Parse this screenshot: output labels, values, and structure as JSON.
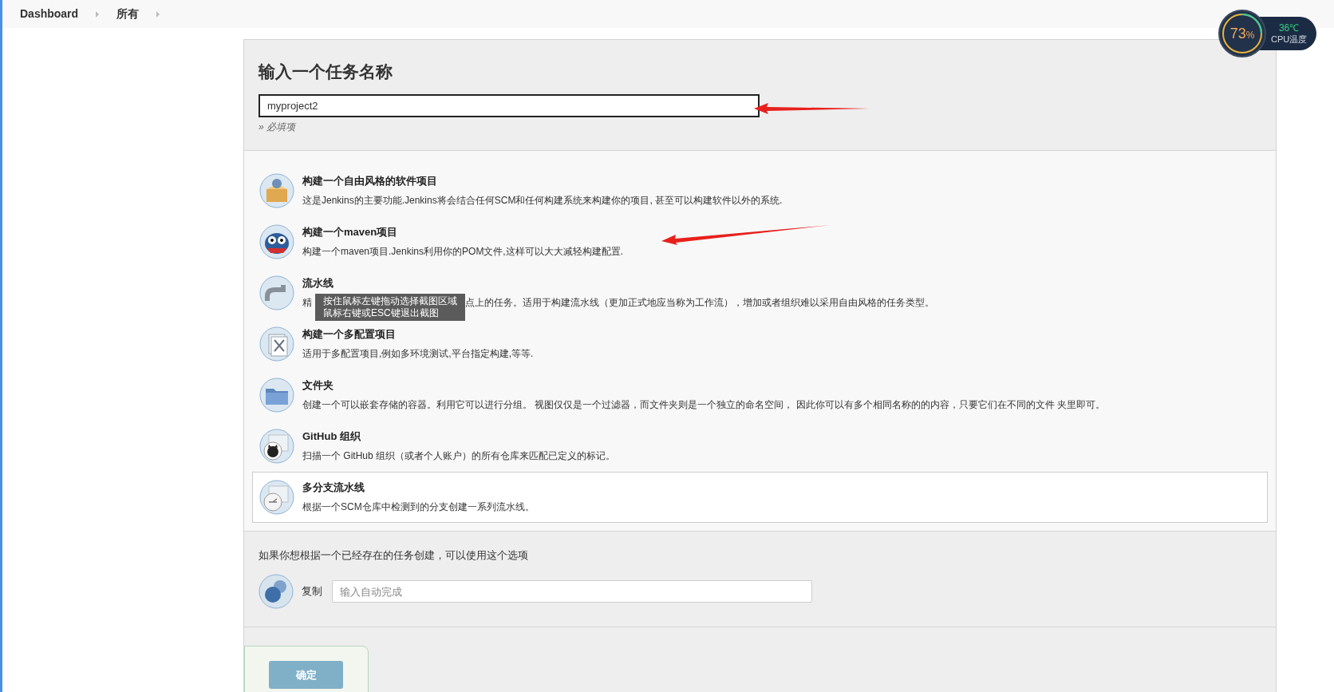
{
  "breadcrumbs": [
    {
      "label": "Dashboard"
    },
    {
      "label": "所有"
    }
  ],
  "form": {
    "title": "输入一个任务名称",
    "name_field": {
      "value": "myproject2"
    },
    "hint": "» 必填项"
  },
  "item_types": [
    {
      "title": "构建一个自由风格的软件项目",
      "description": "这是Jenkins的主要功能.Jenkins将会结合任何SCM和任何构建系统来构建你的项目, 甚至可以构建软件以外的系统.",
      "selected": false
    },
    {
      "title": "构建一个maven项目",
      "description": "构建一个maven项目.Jenkins利用你的POM文件,这样可以大大减轻构建配置.",
      "selected": false
    },
    {
      "title": "流水线",
      "description_parts": [
        "精",
        "点上的任务。适用于构建流水线（更加正式地应当称为工作流），增加或者组织难以采用自由风格的任务类型。"
      ],
      "selected": false
    },
    {
      "title": "构建一个多配置项目",
      "description": "适用于多配置项目,例如多环境测试,平台指定构建,等等.",
      "selected": false
    },
    {
      "title": "文件夹",
      "description": "创建一个可以嵌套存储的容器。利用它可以进行分组。 视图仅仅是一个过滤器，而文件夹则是一个独立的命名空间， 因此你可以有多个相同名称的的内容，只要它们在不同的文件 夹里即可。",
      "selected": false
    },
    {
      "title": "GitHub 组织",
      "description": "扫描一个 GitHub 组织（或者个人账户）的所有仓库来匹配已定义的标记。",
      "selected": false
    },
    {
      "title": "多分支流水线",
      "description": "根据一个SCM仓库中检测到的分支创建一系列流水线。",
      "selected": true
    }
  ],
  "copy_section": {
    "text": "如果你想根据一个已经存在的任务创建，可以使用这个选项",
    "label": "复制",
    "field": {
      "placeholder": "输入自动完成"
    }
  },
  "ok_button": {
    "label": "确定"
  },
  "screenshot_tooltip": {
    "lines": [
      "按住鼠标左键拖动选择截图区域",
      "鼠标右键或ESC键退出截图"
    ]
  },
  "cpu_widget": {
    "percent": "73",
    "unit": "%",
    "temperature": "36℃",
    "label": "CPU温度"
  }
}
